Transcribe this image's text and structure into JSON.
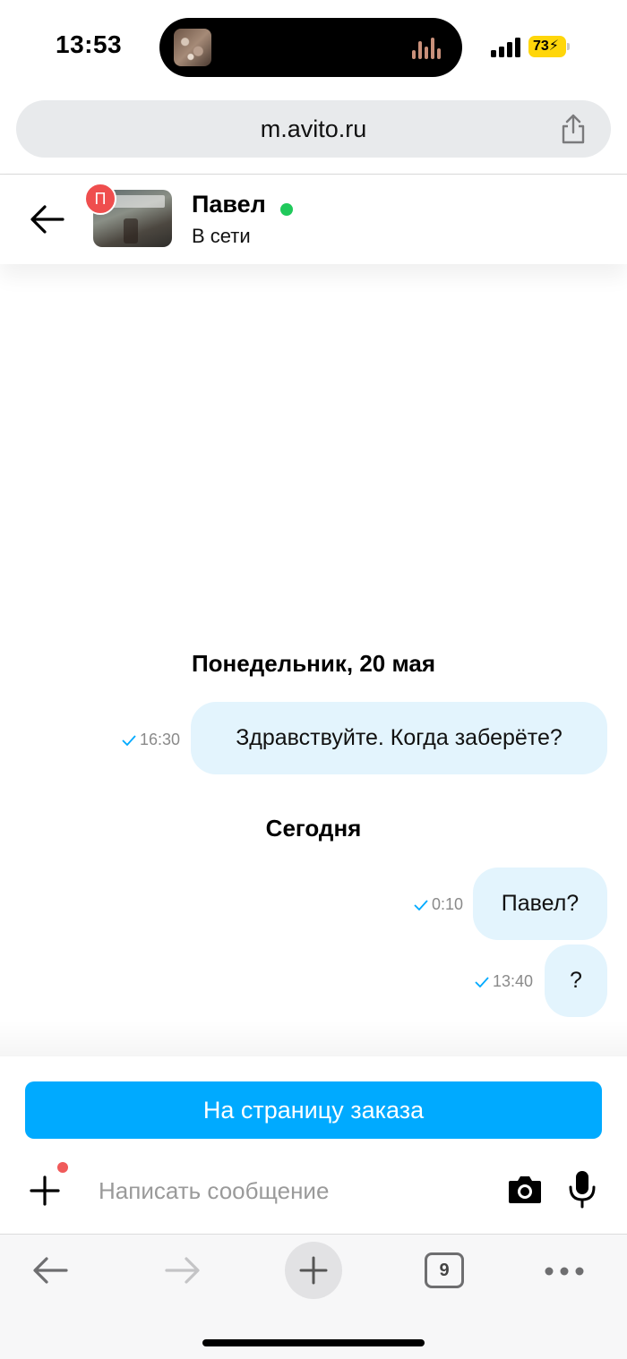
{
  "status_bar": {
    "time": "13:53",
    "battery": "73",
    "signal_icon": "signal-bars-icon",
    "battery_icon": "battery-charging-icon"
  },
  "browser": {
    "url": "m.avito.ru",
    "share_icon": "share-icon",
    "open_tabs": "9"
  },
  "chat": {
    "contact_initial": "П",
    "contact_name": "Павел",
    "contact_status": "В сети",
    "online_color": "#20c95b"
  },
  "messages": {
    "sep1": "Понедельник, 20 мая",
    "m1_text": "Здравствуйте. Когда заберёте?",
    "m1_time": "16:30",
    "sep2": "Сегодня",
    "m2_text": "Павел?",
    "m2_time": "0:10",
    "m3_text": "?",
    "m3_time": "13:40"
  },
  "footer": {
    "order_button": "На страницу заказа",
    "input_placeholder": "Написать сообщение",
    "accent_color": "#00aaff"
  }
}
